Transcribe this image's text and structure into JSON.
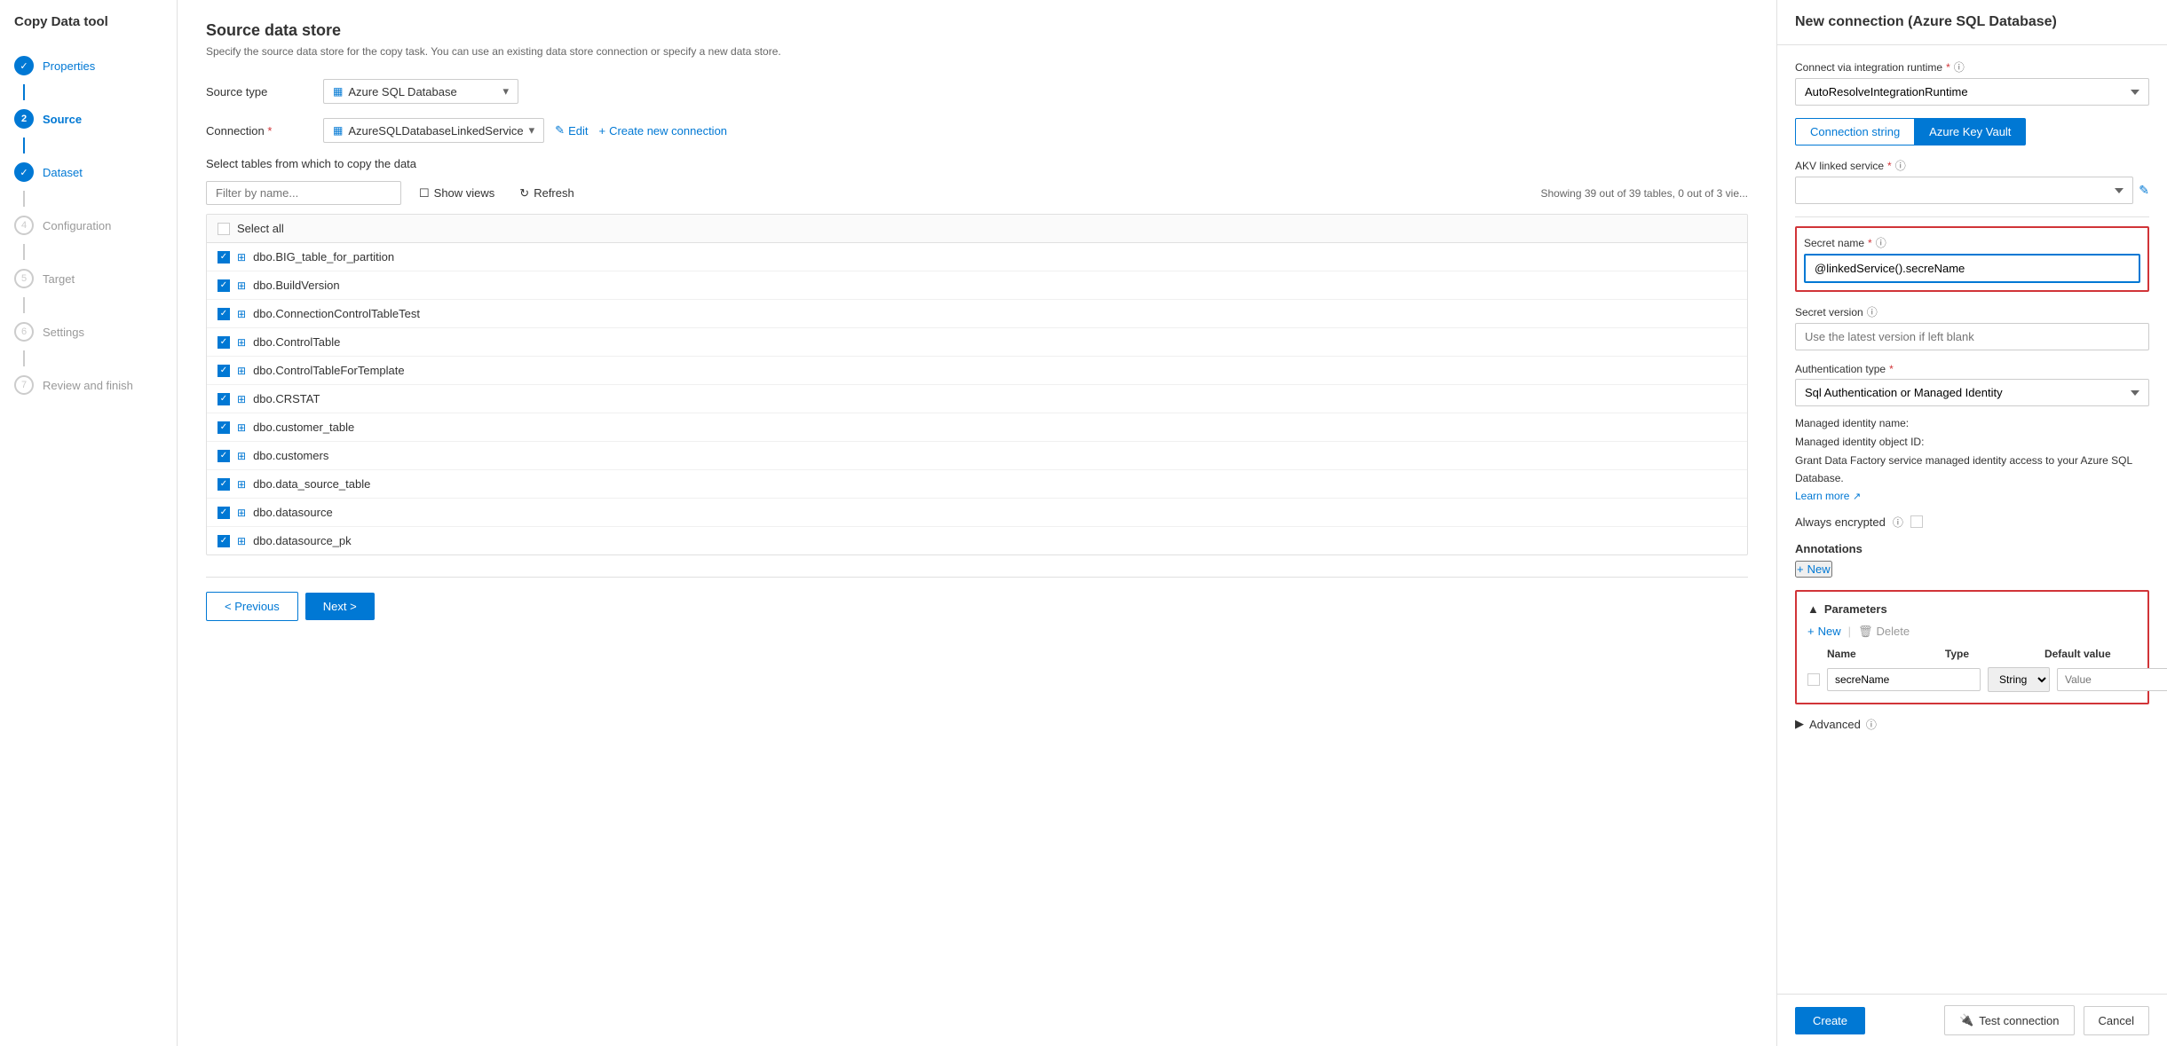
{
  "app": {
    "title": "Copy Data tool"
  },
  "sidebar": {
    "steps": [
      {
        "id": "properties",
        "label": "Properties",
        "state": "completed",
        "number": "✓"
      },
      {
        "id": "source",
        "label": "Source",
        "state": "active",
        "number": "2"
      },
      {
        "id": "dataset",
        "label": "Dataset",
        "state": "completed",
        "number": "✓"
      },
      {
        "id": "configuration",
        "label": "Configuration",
        "state": "inactive",
        "number": "4"
      },
      {
        "id": "target",
        "label": "Target",
        "state": "inactive",
        "number": "5"
      },
      {
        "id": "settings",
        "label": "Settings",
        "state": "inactive",
        "number": "6"
      },
      {
        "id": "review",
        "label": "Review and finish",
        "state": "inactive",
        "number": "7"
      }
    ]
  },
  "main": {
    "title": "Source data store",
    "subtitle": "Specify the source data store for the copy task. You can use an existing data store connection or specify a new data store.",
    "source_type_label": "Source type",
    "source_type_value": "Azure SQL Database",
    "connection_label": "Connection",
    "connection_required": "*",
    "connection_value": "AzureSQLDatabaseLinkedService",
    "edit_label": "Edit",
    "new_connection_label": "Create new connection",
    "table_section_label": "Select tables from which to copy the data",
    "filter_placeholder": "Filter by name...",
    "show_views_label": "Show views",
    "refresh_label": "Refresh",
    "showing_text": "Showing 39 out of 39 tables, 0 out of 3 vie...",
    "select_all_label": "Select all",
    "tables": [
      {
        "name": "dbo.BIG_table_for_partition",
        "checked": true
      },
      {
        "name": "dbo.BuildVersion",
        "checked": true
      },
      {
        "name": "dbo.ConnectionControlTableTest",
        "checked": true
      },
      {
        "name": "dbo.ControlTable",
        "checked": true
      },
      {
        "name": "dbo.ControlTableForTemplate",
        "checked": true
      },
      {
        "name": "dbo.CRSTAT",
        "checked": true
      },
      {
        "name": "dbo.customer_table",
        "checked": true
      },
      {
        "name": "dbo.customers",
        "checked": true
      },
      {
        "name": "dbo.data_source_table",
        "checked": true
      },
      {
        "name": "dbo.datasource",
        "checked": true
      },
      {
        "name": "dbo.datasource_pk",
        "checked": true
      }
    ],
    "prev_label": "< Previous",
    "next_label": "Next >"
  },
  "right_panel": {
    "title": "New connection (Azure SQL Database)",
    "connect_via_label": "Connect via integration runtime",
    "connect_via_required": "*",
    "connect_via_value": "AutoResolveIntegrationRuntime",
    "tab_connection_string": "Connection string",
    "tab_azure_key_vault": "Azure Key Vault",
    "akv_linked_service_label": "AKV linked service",
    "akv_required": "*",
    "akv_value": "",
    "secret_name_label": "Secret name",
    "secret_name_required": "*",
    "secret_name_value": "@linkedService().secreName",
    "secret_version_label": "Secret version",
    "secret_version_placeholder": "Use the latest version if left blank",
    "auth_type_label": "Authentication type",
    "auth_type_required": "*",
    "auth_type_value": "Sql Authentication or Managed Identity",
    "managed_identity_name": "Managed identity name:",
    "managed_identity_object": "Managed identity object ID:",
    "grant_text": "Grant Data Factory service managed identity access to your Azure SQL Database.",
    "learn_more_label": "Learn more",
    "always_encrypted_label": "Always encrypted",
    "annotations_label": "Annotations",
    "new_annotation_label": "New",
    "parameters_title": "Parameters",
    "params_new_label": "New",
    "params_delete_label": "Delete",
    "params_col_name": "Name",
    "params_col_type": "Type",
    "params_col_default": "Default value",
    "params_row": {
      "name": "secreName",
      "type": "String",
      "default_value": "Value"
    },
    "advanced_label": "Advanced",
    "create_label": "Create",
    "test_connection_label": "Test connection",
    "cancel_label": "Cancel"
  }
}
